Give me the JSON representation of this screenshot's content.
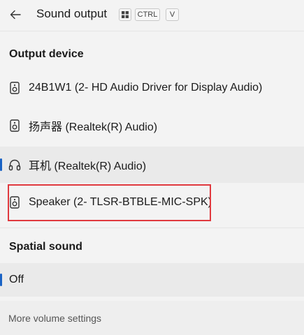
{
  "header": {
    "title": "Sound output",
    "shortcut": {
      "win_icon": "windows-key-icon",
      "ctrl": "CTRL",
      "key": "V"
    }
  },
  "output_device": {
    "section_title": "Output device",
    "devices": [
      {
        "label": "24B1W1 (2- HD Audio Driver for Display Audio)",
        "icon": "speaker-icon",
        "selected": false
      },
      {
        "label": "扬声器 (Realtek(R) Audio)",
        "icon": "speaker-icon",
        "selected": false
      },
      {
        "label": "耳机 (Realtek(R) Audio)",
        "icon": "headphones-icon",
        "selected": true
      },
      {
        "label": "Speaker (2- TLSR-BTBLE-MIC-SPK)",
        "icon": "speaker-icon",
        "selected": false
      }
    ]
  },
  "spatial_sound": {
    "section_title": "Spatial sound",
    "value": "Off"
  },
  "footer": {
    "link": "More volume settings"
  },
  "colors": {
    "accent": "#1a63c5",
    "highlight": "#e0393e",
    "background": "#f3f3f3"
  }
}
